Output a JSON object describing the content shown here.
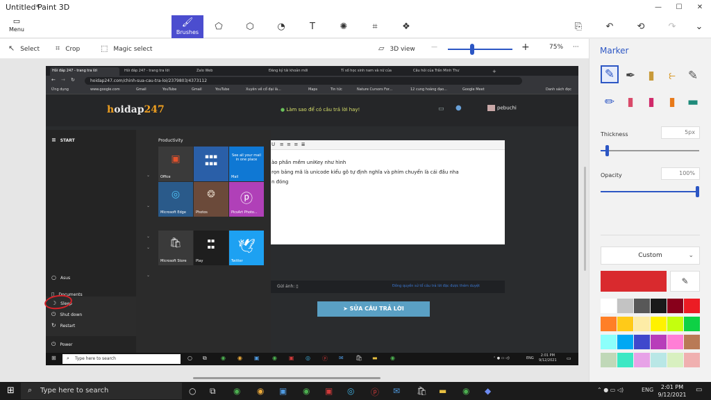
{
  "window": {
    "title": "Untitled*",
    "app": "Paint 3D",
    "minimize": "—",
    "maximize": "☐",
    "close": "✕"
  },
  "toolbar": {
    "menu_label": "Menu",
    "brushes_label": "Brushes",
    "icons": [
      "2d-shapes-icon",
      "3d-shapes-icon",
      "stickers-icon",
      "text-icon",
      "effects-icon",
      "canvas-icon",
      "3d-library-icon"
    ],
    "right_icons": [
      "paste-icon",
      "undo-icon",
      "history-icon",
      "redo-icon",
      "expand-icon"
    ]
  },
  "subbar": {
    "select": "Select",
    "crop": "Crop",
    "magic_select": "Magic select",
    "view_3d": "3D view",
    "zoom_minus": "—",
    "zoom_plus": "+",
    "zoom": "75%",
    "more": "···"
  },
  "browser": {
    "tabs": [
      "Hỏi đáp 247 - trang tra lời",
      "Hỏi đáp 247 - trang tra lời",
      "Zalo Web",
      "Đăng ký tài khoản mới",
      "Tỉ số học sinh nam và nữ của",
      "Câu hỏi của Trần Minh Thư"
    ],
    "url": "hoidap247.com/chinh-sua-cau-tra-loi/2379803/4373112",
    "bookmarks": [
      "Ứng dụng",
      "www.google.com",
      "Gmail",
      "YouTube",
      "Gmail",
      "YouTube",
      "Xuyên về cổ đại là...",
      "Maps",
      "Tin tức",
      "Nature Cursors For...",
      "12 cung hoàng đạo...",
      "Google Meet",
      "Danh sách đọc"
    ]
  },
  "page": {
    "logo_main": "oidap",
    "logo_num": "247",
    "logo_h": "h",
    "prompt": "Làm sao để có câu trả lời hay!",
    "username": "pebuchi",
    "editor_lines": [
      "ào phần mềm uniKey  như hình",
      "rọn bảng mã là unicode  kiểu gõ tự định nghĩa và phím chuyển là cái đầu nha",
      "n đóng"
    ],
    "attach_label": "Gửi ảnh:",
    "rules_link": "Đồng quyền sử tổ câu trả lời đặc được thêm duyệt",
    "submit": "SỬA CÂU TRẢ LỜI"
  },
  "startmenu": {
    "start_label": "START",
    "section": "Productivity",
    "user": "Asus",
    "documents": "Documents",
    "sleep": "Sleep",
    "shutdown": "Shut down",
    "restart": "Restart",
    "power": "Power",
    "tiles": {
      "office": "Office",
      "mail": "Mail",
      "mail_promo": "See all your mail in one place",
      "edge": "Microsoft Edge",
      "photos": "Photos",
      "picsart": "PicsArt Photo...",
      "store": "Microsoft Store",
      "play": "Play",
      "twitter": "Twitter"
    },
    "search_placeholder": "Type here to search",
    "clock_time": "2:01 PM",
    "clock_date": "9/12/2021",
    "lang": "ENG"
  },
  "panel": {
    "title": "Marker",
    "thickness_label": "Thickness",
    "thickness_value": "5px",
    "thickness_level": 0.05,
    "opacity_label": "Opacity",
    "opacity_value": "100%",
    "opacity_level": 1.0,
    "color_mode": "Custom",
    "selected_color": "#d92a2e",
    "palette": [
      "#ffffff",
      "#c3c3c3",
      "#585858",
      "#1a1a1a",
      "#88001b",
      "#ec1c24",
      "#ff7f27",
      "#ffca18",
      "#fdeca6",
      "#fff200",
      "#c4ff0e",
      "#0ed145",
      "#8cfffb",
      "#00a8f3",
      "#3f48cc",
      "#b83dba",
      "#ff7ed6",
      "#b97a56",
      "#c0d8b8",
      "#3ce8c4",
      "#e7a2e7",
      "#b9e7e6",
      "#d8f0c0",
      "#f0b0b0"
    ]
  },
  "taskbar": {
    "search_placeholder": "Type here to search",
    "lang": "ENG",
    "time": "2:01 PM",
    "date": "9/12/2021"
  }
}
